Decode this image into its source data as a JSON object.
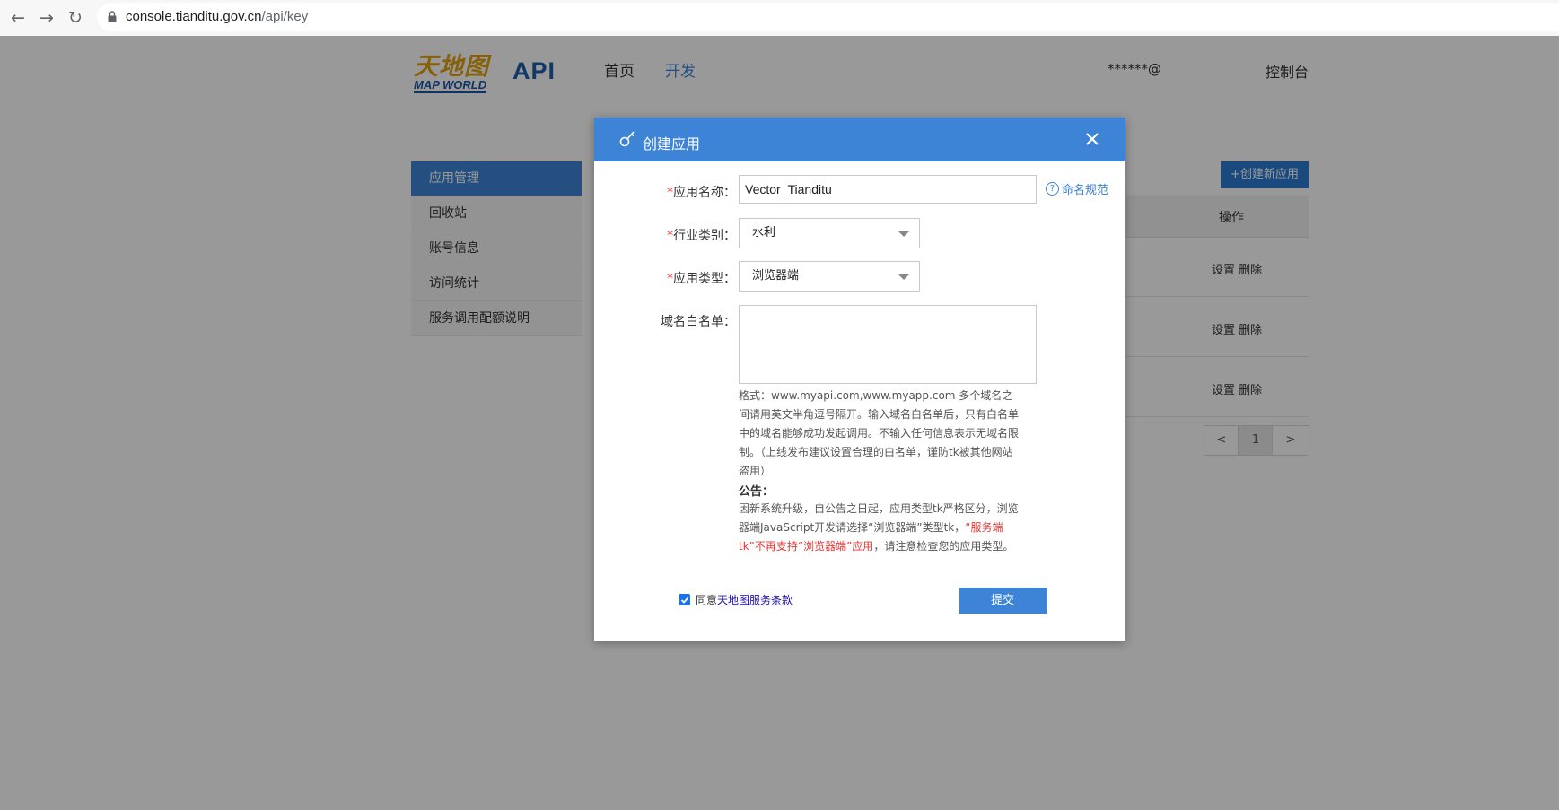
{
  "browser": {
    "url_host": "console.tianditu.gov.cn",
    "url_path": "/api/key"
  },
  "header": {
    "logo_cn": "天地图",
    "logo_en": "MAP WORLD",
    "logo_api": "API",
    "nav": [
      "首页",
      "开发"
    ],
    "user_email": "******@",
    "console_link": "控制台"
  },
  "sidebar": {
    "items": [
      {
        "label": "应用管理",
        "active": true
      },
      {
        "label": "回收站",
        "active": false
      },
      {
        "label": "账号信息",
        "active": false
      },
      {
        "label": "访问统计",
        "active": false
      },
      {
        "label": "服务调用配额说明",
        "active": false
      }
    ]
  },
  "main": {
    "new_app_button": "+创建新应用",
    "table_header_ops": "操作",
    "row_actions": [
      "设置 删除",
      "设置 删除",
      "设置 删除"
    ],
    "pager": {
      "prev": "<",
      "current": "1",
      "next": ">"
    }
  },
  "modal": {
    "title": "创建应用",
    "fields": {
      "app_name_label": "应用名称：",
      "app_name_value": "Vector_Tianditu",
      "naming_rule_link": "命名规范",
      "industry_label": "行业类别：",
      "industry_value": "水利",
      "app_type_label": "应用类型：",
      "app_type_value": "浏览器端",
      "whitelist_label": "域名白名单："
    },
    "format_hint": "格式：www.myapi.com,www.myapp.com 多个域名之间请用英文半角逗号隔开。输入域名白名单后，只有白名单中的域名能够成功发起调用。不输入任何信息表示无域名限制。（上线发布建议设置合理的白名单，谨防tk被其他网站盗用）",
    "notice_title": "公告：",
    "notice_part1": "因新系统升级，自公告之日起，应用类型tk严格区分，浏览器端JavaScript开发请选择“浏览器端”类型tk，",
    "notice_red": "“服务端tk”不再支持“浏览器端”应用",
    "notice_part2": "，请注意检查您的应用类型。",
    "agree_prefix": "同意",
    "agree_link": "天地图服务条款",
    "submit_label": "提交"
  },
  "colors": {
    "primary": "#3d84d6",
    "required_star": "#e53935",
    "overlay": "rgba(0,0,0,0.40)"
  }
}
